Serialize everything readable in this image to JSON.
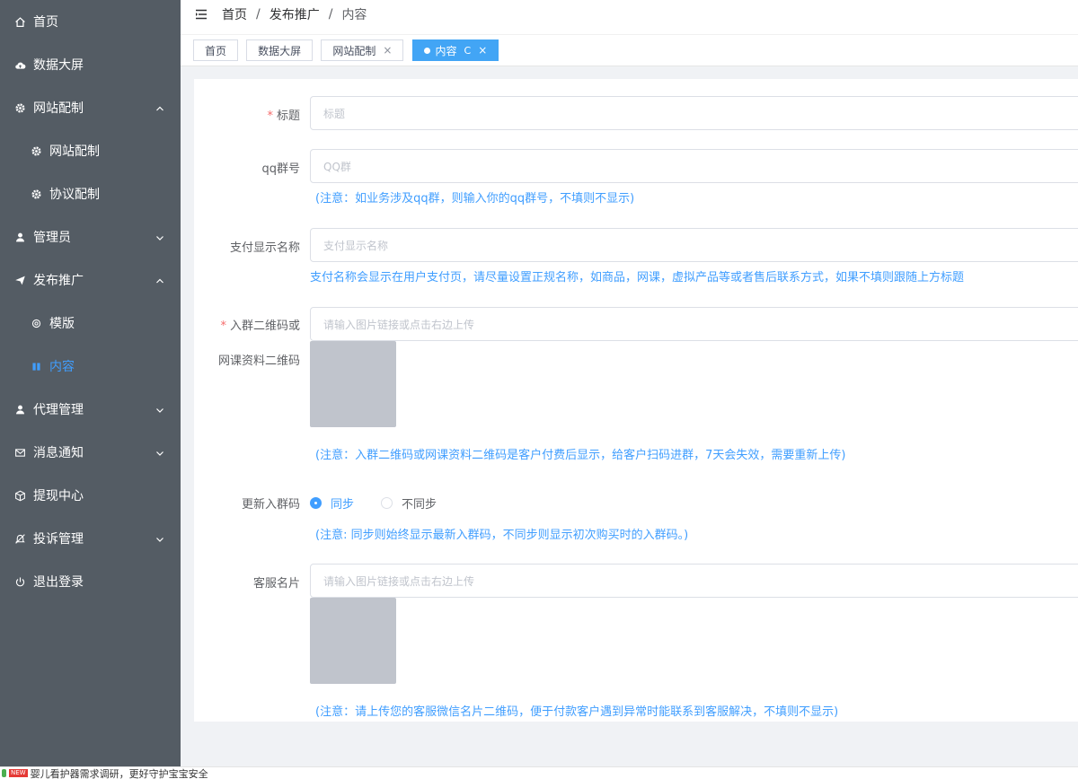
{
  "sidebar": {
    "items": [
      {
        "label": "首页",
        "icon": "home-icon"
      },
      {
        "label": "数据大屏",
        "icon": "cloud-upload-icon"
      },
      {
        "label": "网站配制",
        "icon": "gear-icon",
        "expanded": true
      },
      {
        "label": "网站配制",
        "icon": "gear-icon"
      },
      {
        "label": "协议配制",
        "icon": "gear-icon"
      },
      {
        "label": "管理员",
        "icon": "user-icon"
      },
      {
        "label": "发布推广",
        "icon": "send-icon",
        "expanded": true
      },
      {
        "label": "模版",
        "icon": "settings-outline-icon"
      },
      {
        "label": "内容",
        "icon": "book-icon",
        "active": true
      },
      {
        "label": "代理管理",
        "icon": "user-icon"
      },
      {
        "label": "消息通知",
        "icon": "mail-icon"
      },
      {
        "label": "提现中心",
        "icon": "cube-icon"
      },
      {
        "label": "投诉管理",
        "icon": "bell-off-icon"
      },
      {
        "label": "退出登录",
        "icon": "power-icon"
      }
    ]
  },
  "breadcrumb": {
    "items": [
      "首页",
      "发布推广",
      "内容"
    ]
  },
  "tags": {
    "items": [
      {
        "label": "首页"
      },
      {
        "label": "数据大屏"
      },
      {
        "label": "网站配制",
        "close": "×"
      },
      {
        "label": "内容",
        "refresh": "C",
        "close": "×",
        "active": true
      }
    ]
  },
  "form": {
    "title": {
      "label": "标题",
      "placeholder": "标题"
    },
    "qq": {
      "label": "qq群号",
      "placeholder": "QQ群",
      "hint": "(注意：如业务涉及qq群，则输入你的qq群号，不填则不显示)"
    },
    "pay_name": {
      "label": "支付显示名称",
      "placeholder": "支付显示名称",
      "hint": "支付名称会显示在用户支付页，请尽量设置正规名称，如商品，网课，虚拟产品等或者售后联系方式，如果不填则跟随上方标题"
    },
    "qrcode": {
      "label_line1": "入群二维码或",
      "label_line2": "网课资料二维码",
      "placeholder": "请输入图片链接或点击右边上传",
      "hint": "(注意：入群二维码或网课资料二维码是客户付费后显示，给客户扫码进群，7天会失效，需要重新上传)"
    },
    "update": {
      "label": "更新入群码",
      "option_sync": "同步",
      "option_nosync": "不同步",
      "selected": "同步",
      "hint": "(注意: 同步则始终显示最新入群码，不同步则显示初次购买时的入群码。)"
    },
    "card": {
      "label": "客服名片",
      "placeholder": "请输入图片链接或点击右边上传",
      "hint": "(注意：请上传您的客服微信名片二维码，便于付款客户遇到异常时能联系到客服解决，不填则不显示)"
    }
  },
  "statusbar": {
    "badge": "NEW",
    "text": "婴儿看护器需求调研，更好守护宝宝安全"
  }
}
